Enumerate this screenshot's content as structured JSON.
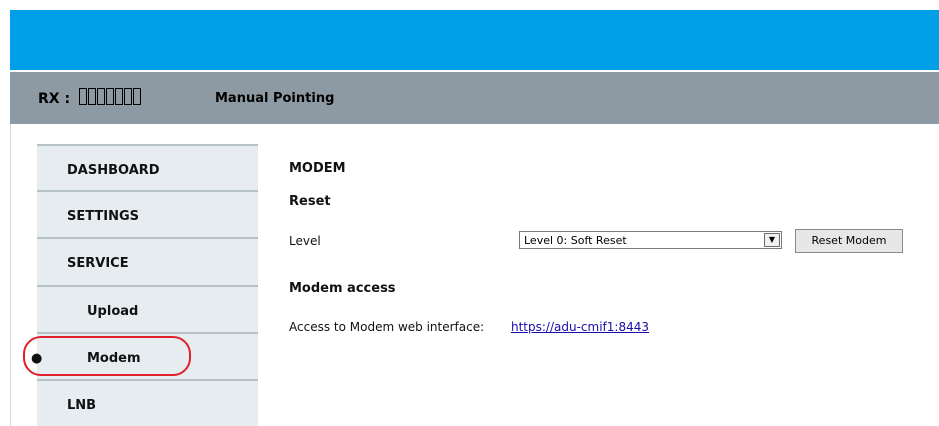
{
  "header": {
    "rx_label": "RX :",
    "mode_label": "Manual Pointing"
  },
  "sidebar": {
    "items": [
      {
        "label": "DASHBOARD"
      },
      {
        "label": "SETTINGS"
      },
      {
        "label": "SERVICE"
      },
      {
        "label": "Upload"
      },
      {
        "label": "Modem",
        "active": true
      },
      {
        "label": "LNB"
      }
    ]
  },
  "main": {
    "title": "MODEM",
    "reset_heading": "Reset",
    "level_label": "Level",
    "level_value": "Level 0: Soft Reset",
    "reset_button": "Reset Modem",
    "access_heading": "Modem access",
    "access_text": "Access to Modem web interface:",
    "access_link": "https://adu-cmif1:8443"
  },
  "colors": {
    "top_bar": "#009fe8",
    "status_bar": "#8e9aa3",
    "sidebar_bg": "#e6ecef",
    "highlight": "#e0202a",
    "link": "#1a0dab"
  }
}
